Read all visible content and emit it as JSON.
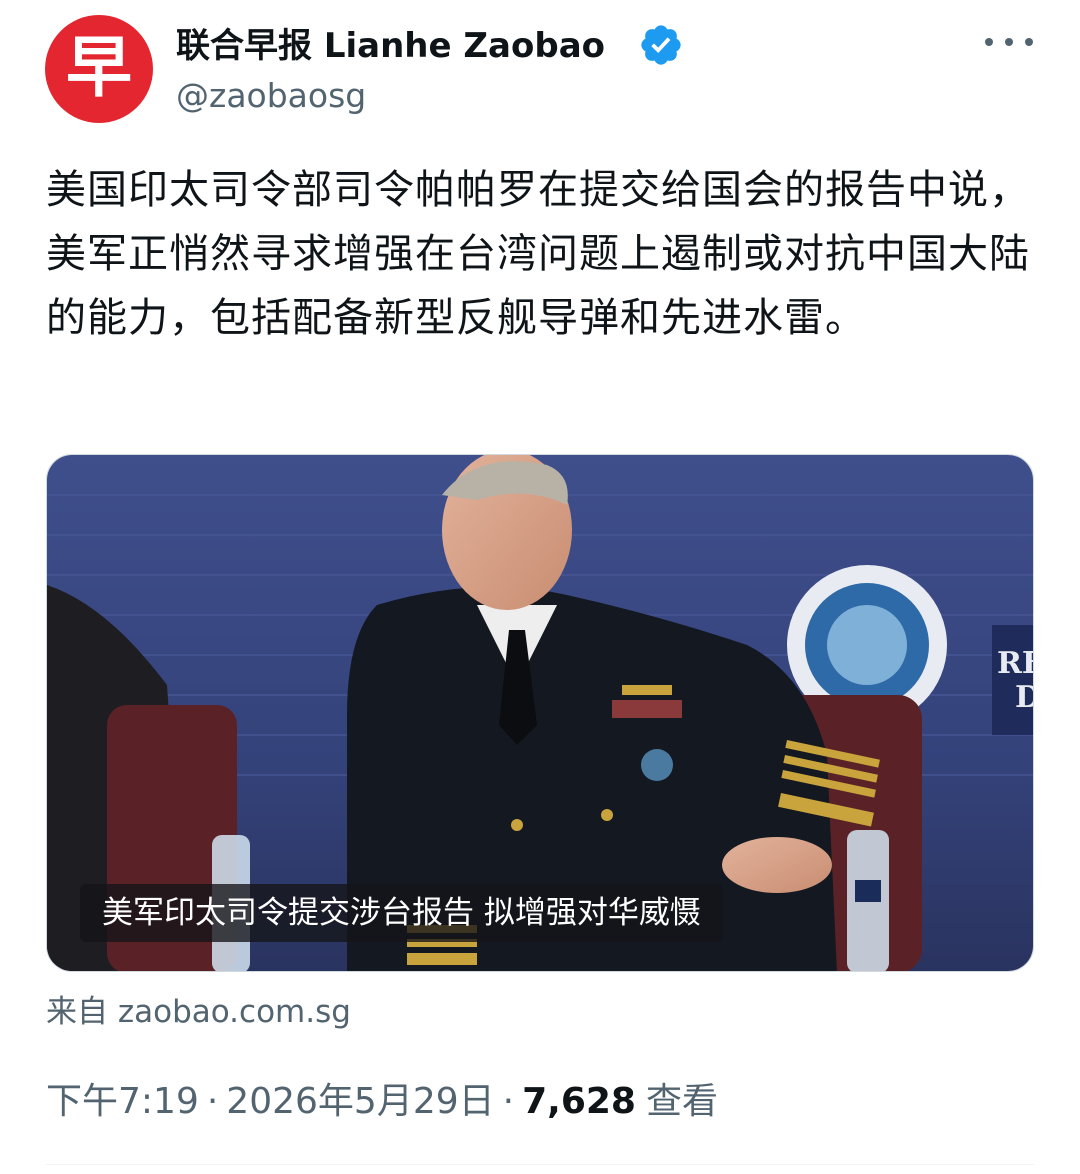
{
  "account": {
    "avatar_glyph": "早",
    "display_name": "联合早报 Lianhe Zaobao",
    "handle": "@zaobaosg",
    "verified": true
  },
  "tweet": {
    "text": "美国印太司令部司令帕帕罗在提交给国会的报告中说，美军正悄然寻求增强在台湾问题上遏制或对抗中国大陆的能力，包括配备新型反舰导弹和先进水雷。"
  },
  "media": {
    "caption": "美军印太司令提交涉台报告 拟增强对华威慑",
    "backdrop_text": "RE D"
  },
  "link_source": "来自 zaobao.com.sg",
  "meta": {
    "time": "下午7:19",
    "date": "2026年5月29日",
    "views_count": "7,628",
    "views_label": "查看",
    "separator": "·"
  },
  "colors": {
    "brand_red": "#e3262f",
    "verified_blue": "#1d9bf0",
    "secondary_text": "#536471"
  }
}
